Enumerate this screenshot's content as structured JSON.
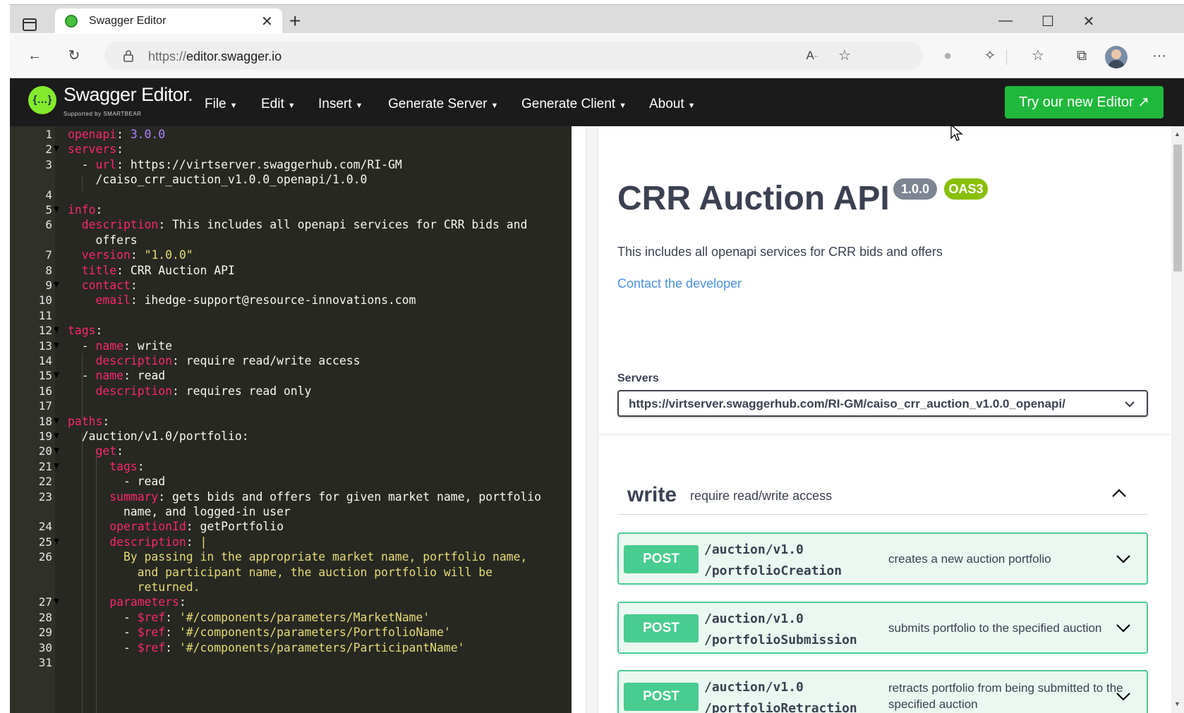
{
  "browser": {
    "tab_title": "Swagger Editor",
    "tab_close": "✕",
    "new_tab": "+",
    "url_scheme": "https://",
    "url_host": "editor.swagger.io",
    "icons": [
      "tab-actions-icon",
      "back-icon",
      "refresh-icon",
      "lock-icon",
      "read-aloud-icon",
      "add-favorite-icon",
      "extension-icon",
      "extensions-icon",
      "favorites-icon",
      "collections-icon",
      "profile-avatar",
      "more-icon"
    ],
    "window_controls": [
      "minimize",
      "maximize",
      "close"
    ]
  },
  "topbar": {
    "brand": "Swagger Editor.",
    "brand_sub": "Supported by SMARTBEAR",
    "logo_glyph": "{…}",
    "menus": [
      {
        "label": "File"
      },
      {
        "label": "Edit"
      },
      {
        "label": "Insert"
      },
      {
        "label": "Generate Server"
      },
      {
        "label": "Generate Client"
      },
      {
        "label": "About"
      }
    ],
    "caret": "▼",
    "try_button": "Try our new Editor ↗"
  },
  "editor": {
    "line_numbers": [
      "1",
      "2",
      "3",
      "",
      "4",
      "5",
      "6",
      "",
      "7",
      "8",
      "9",
      "10",
      "11",
      "12",
      "13",
      "14",
      "15",
      "16",
      "17",
      "18",
      "19",
      "20",
      "21",
      "22",
      "23",
      "",
      "24",
      "25",
      "26",
      "",
      "",
      "27",
      "28",
      "29",
      "30",
      "31"
    ],
    "lines": [
      "openapi: 3.0.0",
      "servers:",
      "  - url: https://virtserver.swaggerhub.com/RI-GM",
      "    /caiso_crr_auction_v1.0.0_openapi/1.0.0",
      "",
      "info:",
      "  description: This includes all openapi services for CRR bids and",
      "    offers",
      "  version: \"1.0.0\"",
      "  title: CRR Auction API",
      "  contact:",
      "    email: ihedge-support@resource-innovations.com",
      "",
      "tags:",
      "  - name: write",
      "    description: require read/write access",
      "  - name: read",
      "    description: requires read only",
      "",
      "paths:",
      "  /auction/v1.0/portfolio:",
      "    get:",
      "      tags:",
      "        - read",
      "      summary: gets bids and offers for given market name, portfolio",
      "        name, and logged-in user",
      "      operationId: getPortfolio",
      "      description: |",
      "        By passing in the appropriate market name, portfolio name,",
      "          and participant name, the auction portfolio will be",
      "          returned.",
      "      parameters:",
      "        - $ref: '#/components/parameters/MarketName'",
      "        - $ref: '#/components/parameters/PortfolioName'",
      "        - $ref: '#/components/parameters/ParticipantName'",
      ""
    ]
  },
  "preview": {
    "title": "CRR Auction API",
    "version_badge": "1.0.0",
    "oas_badge": "OAS3",
    "description": "This includes all openapi services for CRR bids and offers",
    "contact_link": "Contact the developer",
    "servers_label": "Servers",
    "servers_value": "https://virtserver.swaggerhub.com/RI-GM/caiso_crr_auction_v1.0.0_openapi/",
    "tag": {
      "name": "write",
      "description": "require read/write access"
    },
    "operations": [
      {
        "method": "POST",
        "path1": "/auction/v1.0",
        "path2": "/portfolioCreation",
        "summary1": "creates a new auction portfolio",
        "summary2": ""
      },
      {
        "method": "POST",
        "path1": "/auction/v1.0",
        "path2": "/portfolioSubmission",
        "summary1": "submits portfolio to the specified auction",
        "summary2": ""
      },
      {
        "method": "POST",
        "path1": "/auction/v1.0",
        "path2": "/portfolioRetraction",
        "summary1": "retracts portfolio from being submitted to the",
        "summary2": "specified auction"
      }
    ]
  },
  "colors": {
    "topbar_bg": "#1b1b1b",
    "brand_green": "#85ea2d",
    "try_button_bg": "#20b83c",
    "editor_bg": "#272822",
    "yaml_key": "#f92672",
    "post_green": "#49cc90",
    "link_blue": "#4990e2",
    "badge_gray": "#7d8492",
    "badge_green": "#89bf04"
  }
}
